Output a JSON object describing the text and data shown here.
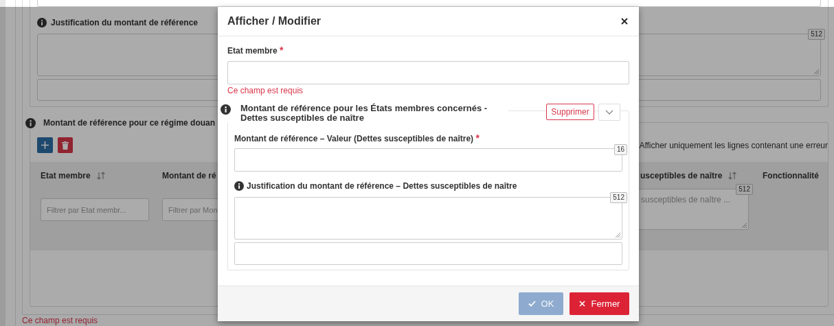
{
  "background_form": {
    "justification": {
      "label": "Justification du montant de référence",
      "counter": "512"
    },
    "section_title": "Montant de référence pour ce régime douan",
    "error_filter_label": "Afficher uniquement les lignes contenant une erreur",
    "table": {
      "columns": [
        {
          "label": "Etat membre",
          "sortable": true,
          "filter": {
            "kind": "input",
            "placeholder": "Filtrer par Etat membr..."
          }
        },
        {
          "label": "Montant de ré",
          "filter": {
            "kind": "input",
            "placeholder": "Filtrer par Mon"
          }
        },
        {
          "label": "usceptibles de naître",
          "sortable": true,
          "filter": {
            "kind": "textarea",
            "placeholder": "susceptibles de naître ...",
            "counter": "512"
          }
        },
        {
          "label": "Fonctionnalité"
        }
      ]
    },
    "error": "Ce champ est requis"
  },
  "dialog": {
    "title": "Afficher / Modifier",
    "etat_membre": {
      "label": "Etat membre",
      "required_mark": "*",
      "error": "Ce champ est requis"
    },
    "group": {
      "title": "Montant de référence pour les États membres concernés - Dettes susceptibles de naître",
      "delete_button": "Supprimer",
      "value": {
        "label": "Montant de référence – Valeur (Dettes susceptibles de naître)",
        "required_mark": "*",
        "counter": "16"
      },
      "justification": {
        "label": "Justification du montant de référence – Dettes susceptibles de naître",
        "counter": "512"
      }
    },
    "buttons": [
      {
        "kind": "ok",
        "label": "OK",
        "disabled": true
      },
      {
        "kind": "close",
        "label": "Fermer",
        "disabled": false
      }
    ]
  }
}
